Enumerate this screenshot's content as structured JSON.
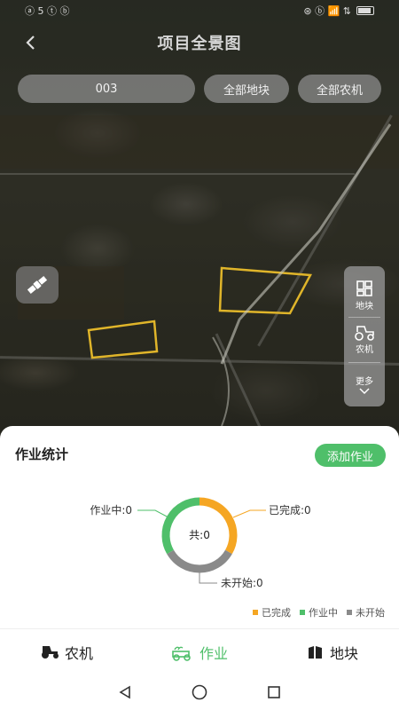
{
  "status_bar": {
    "left": "ⓐ 5 ⓣ ⓑ",
    "right": "⊛ ⓑ 📶 ⇅"
  },
  "header": {
    "title": "项目全景图"
  },
  "filters": {
    "search_value": "003",
    "plot_label": "全部地块",
    "machine_label": "全部农机"
  },
  "side_panel": {
    "plot_label": "地块",
    "machine_label": "农机",
    "more_label": "更多"
  },
  "stats": {
    "title": "作业统计",
    "add_button": "添加作业",
    "center_label": "共:0",
    "working_label": "作业中:0",
    "done_label": "已完成:0",
    "pending_label": "未开始:0",
    "legend": [
      {
        "label": "已完成",
        "color": "#f5a623"
      },
      {
        "label": "作业中",
        "color": "#4fbf6a"
      },
      {
        "label": "未开始",
        "color": "#8a8a8a"
      }
    ],
    "donut_shares": {
      "done": 0.333,
      "working": 0.333,
      "pending": 0.334
    }
  },
  "tabs": [
    {
      "label": "农机",
      "icon": "tractor-icon",
      "active": false
    },
    {
      "label": "作业",
      "icon": "work-icon",
      "active": true
    },
    {
      "label": "地块",
      "icon": "plot-icon",
      "active": false
    }
  ],
  "colors": {
    "accent": "#4fbf6a",
    "done": "#f5a623",
    "pending": "#8a8a8a",
    "plot_outline": "#e0b52a"
  }
}
